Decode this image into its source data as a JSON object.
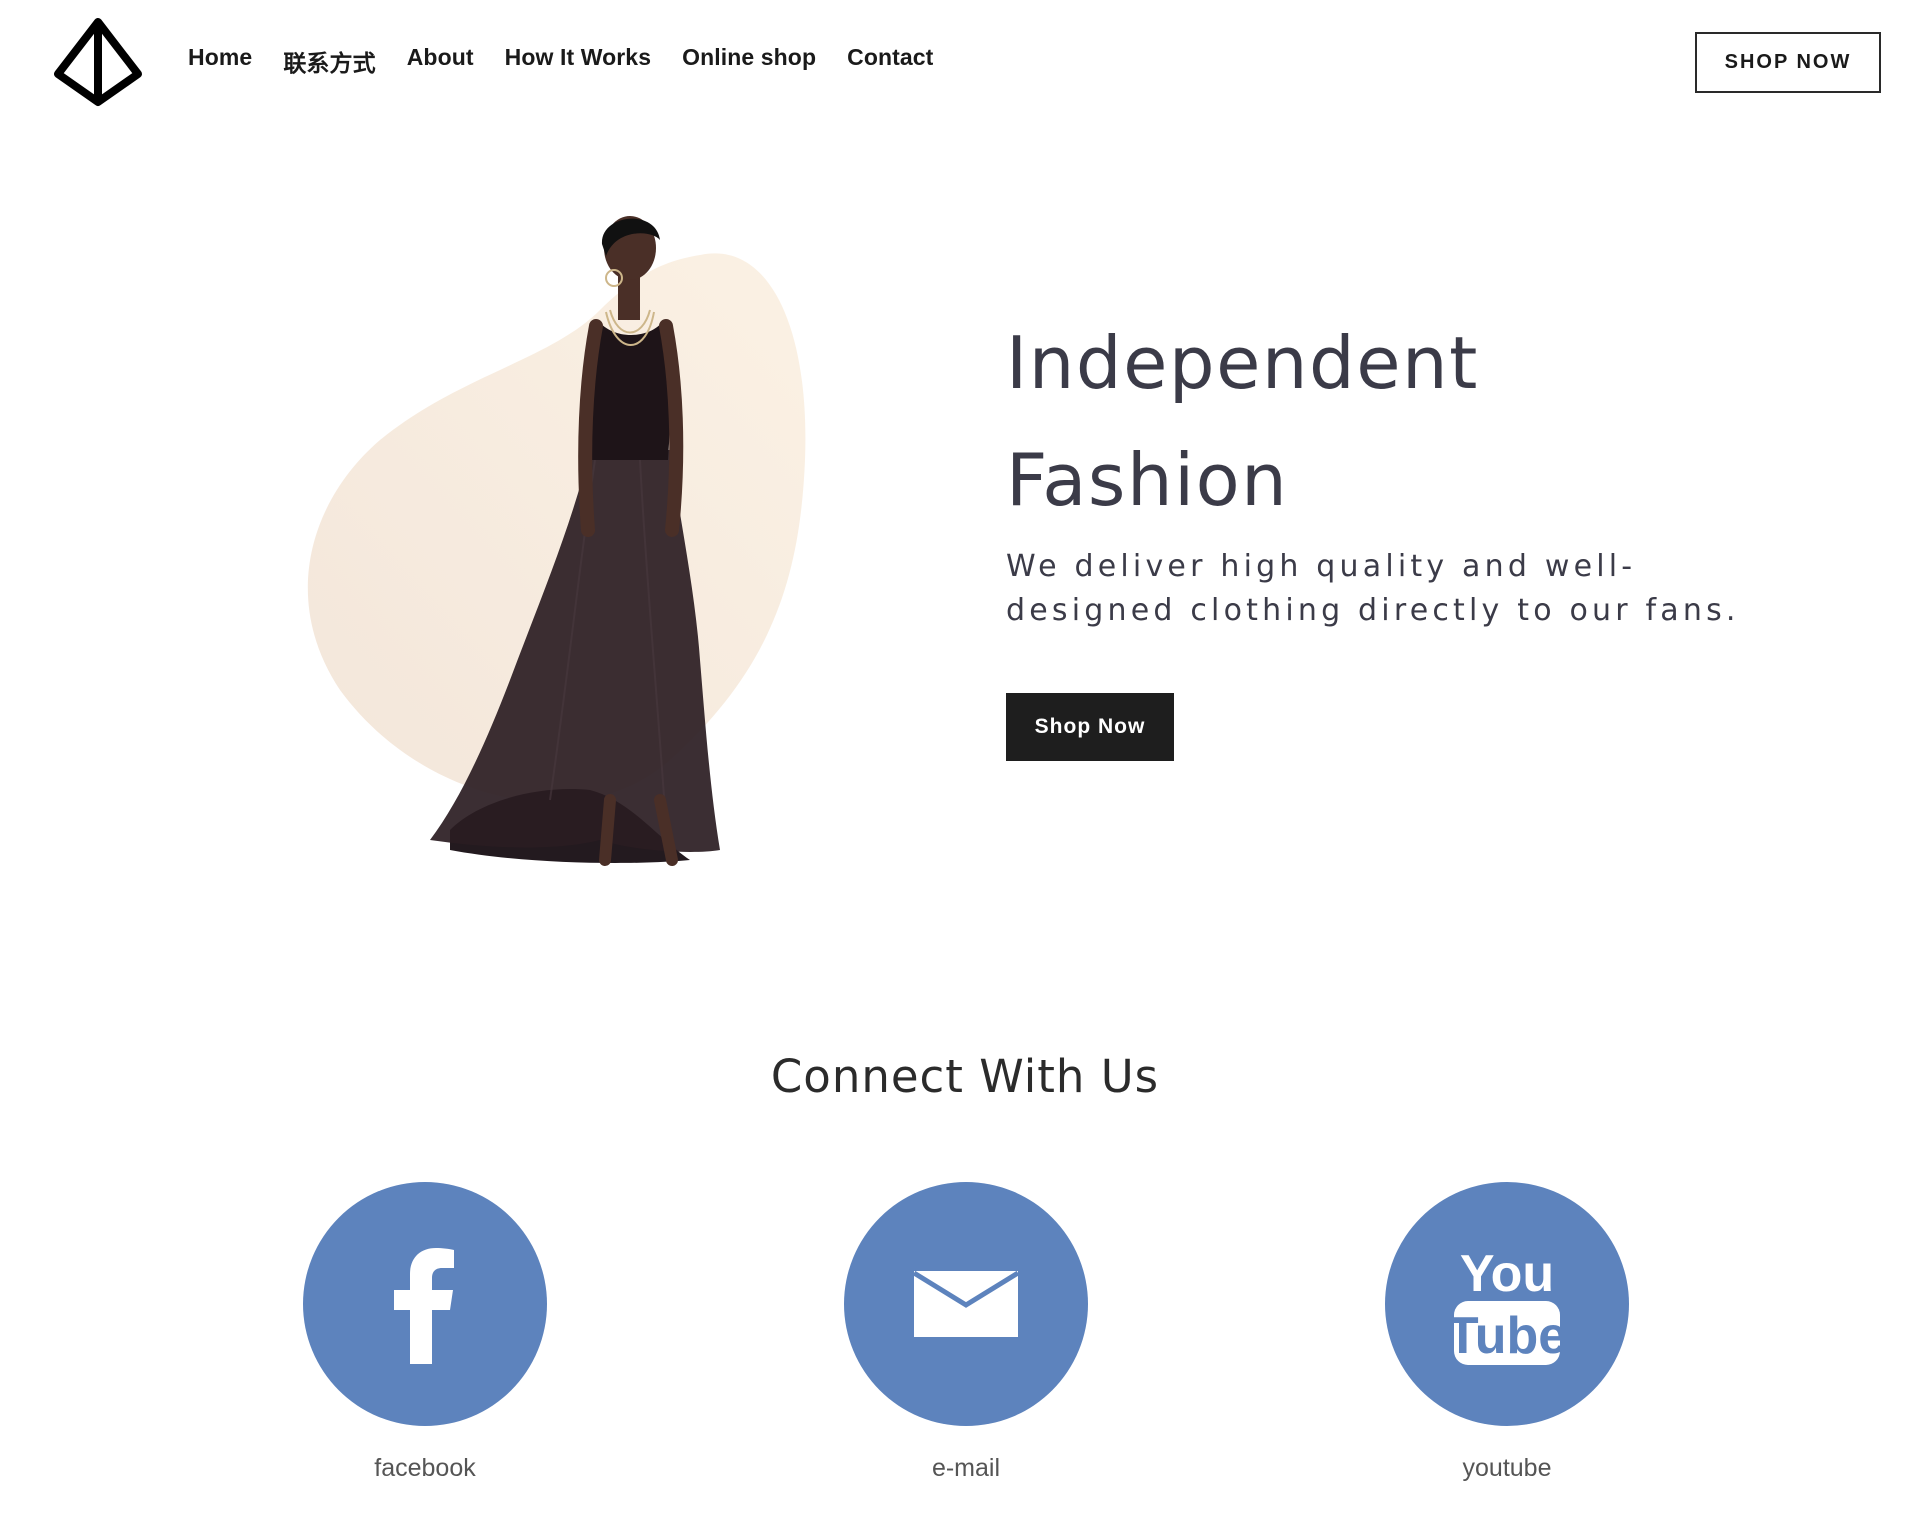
{
  "header": {
    "logo_icon": "diamond-logo-icon",
    "nav": [
      "Home",
      "联系方式",
      "About",
      "How It Works",
      "Online shop",
      "Contact"
    ],
    "cta_label": "SHOP NOW"
  },
  "hero": {
    "title_line1": "Independent",
    "title_line2": "Fashion",
    "subtitle_line1": "We deliver high quality and well-",
    "subtitle_line2": "designed clothing directly to our fans.",
    "button_label": "Shop Now",
    "image": "model-in-black-gown-image"
  },
  "connect": {
    "title": "Connect With Us",
    "items": [
      {
        "label": "facebook",
        "icon": "facebook-icon"
      },
      {
        "label": "e-mail",
        "icon": "email-icon"
      },
      {
        "label": "youtube",
        "icon": "youtube-icon"
      }
    ]
  },
  "colors": {
    "social_circle": "#5d83bd",
    "button_dark": "#1e1e1e",
    "blob_light": "#f7eee3"
  }
}
